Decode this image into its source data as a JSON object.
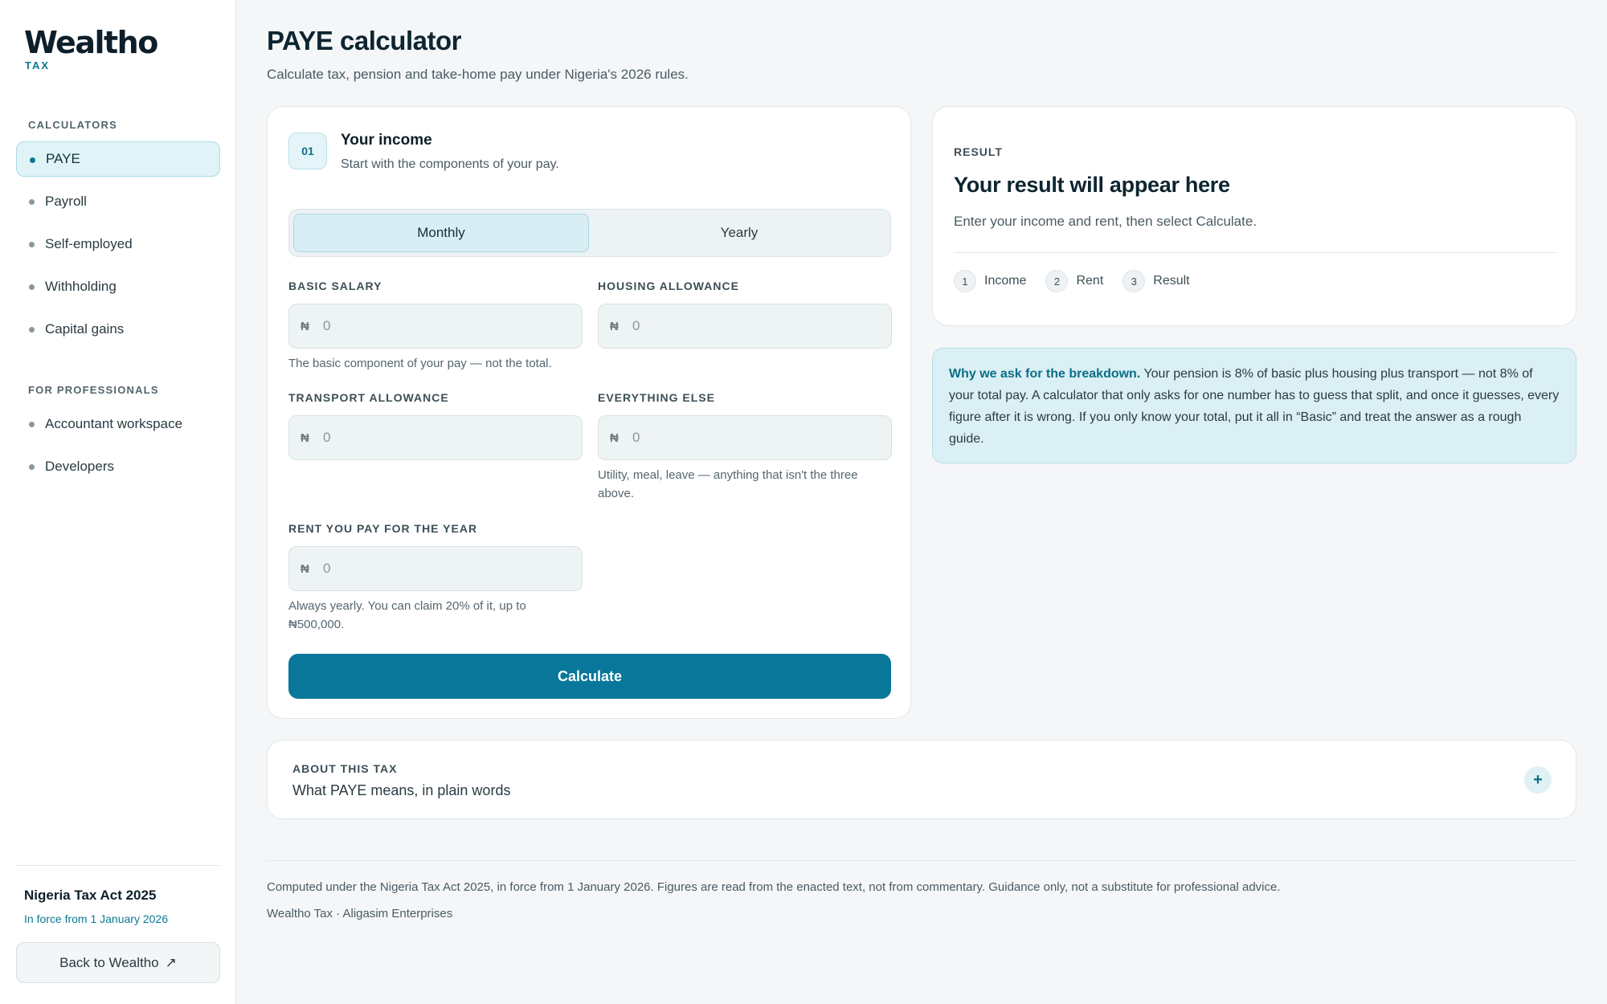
{
  "brand": {
    "name": "Wealtho",
    "tag": "TAX"
  },
  "sidebar": {
    "heading_calculators": "CALCULATORS",
    "calculators": [
      {
        "label": "PAYE",
        "active": true
      },
      {
        "label": "Payroll",
        "active": false
      },
      {
        "label": "Self-employed",
        "active": false
      },
      {
        "label": "Withholding",
        "active": false
      },
      {
        "label": "Capital gains",
        "active": false
      }
    ],
    "heading_professionals": "FOR PROFESSIONALS",
    "professionals": [
      {
        "label": "Accountant workspace"
      },
      {
        "label": "Developers"
      }
    ],
    "act_title": "Nigeria Tax Act 2025",
    "act_sub": "In force from 1 January 2026",
    "back_label": "Back to Wealtho",
    "back_icon": "↗"
  },
  "header": {
    "title": "PAYE calculator",
    "subtitle": "Calculate tax, pension and take-home pay under Nigeria's 2026 rules."
  },
  "income": {
    "step": "01",
    "title": "Your income",
    "subtitle": "Start with the components of your pay.",
    "period_options": [
      "Monthly",
      "Yearly"
    ],
    "period_selected": "Monthly",
    "currency_symbol": "₦",
    "fields": {
      "basic": {
        "label": "BASIC SALARY",
        "placeholder": "0",
        "hint": "The basic component of your pay — not the total."
      },
      "housing": {
        "label": "HOUSING ALLOWANCE",
        "placeholder": "0"
      },
      "transport": {
        "label": "TRANSPORT ALLOWANCE",
        "placeholder": "0"
      },
      "other": {
        "label": "EVERYTHING ELSE",
        "placeholder": "0",
        "hint": "Utility, meal, leave — anything that isn't the three above."
      },
      "rent": {
        "label": "RENT YOU PAY FOR THE YEAR",
        "placeholder": "0",
        "hint": "Always yearly. You can claim 20% of it, up to ₦500,000."
      }
    },
    "calculate_label": "Calculate"
  },
  "result": {
    "label": "RESULT",
    "title": "Your result will appear here",
    "subtitle": "Enter your income and rent, then select Calculate.",
    "steps": [
      {
        "num": "1",
        "label": "Income"
      },
      {
        "num": "2",
        "label": "Rent"
      },
      {
        "num": "3",
        "label": "Result"
      }
    ]
  },
  "info": {
    "lead": "Why we ask for the breakdown.",
    "body": " Your pension is 8% of basic plus housing plus transport — not 8% of your total pay. A calculator that only asks for one number has to guess that split, and once it guesses, every figure after it is wrong. If you only know your total, put it all in “Basic” and treat the answer as a rough guide."
  },
  "about": {
    "label": "ABOUT THIS TAX",
    "title": "What PAYE means, in plain words",
    "toggle_icon": "+"
  },
  "footer": {
    "text": "Computed under the Nigeria Tax Act 2025, in force from 1 January 2026. Figures are read from the enacted text, not from commentary. Guidance only, not a substitute for professional advice.",
    "brand": "Wealtho Tax · Aligasim Enterprises"
  },
  "colors": {
    "accent": "#08779a",
    "accent_light": "#dbf0f5",
    "text_dark": "#0d2530"
  }
}
